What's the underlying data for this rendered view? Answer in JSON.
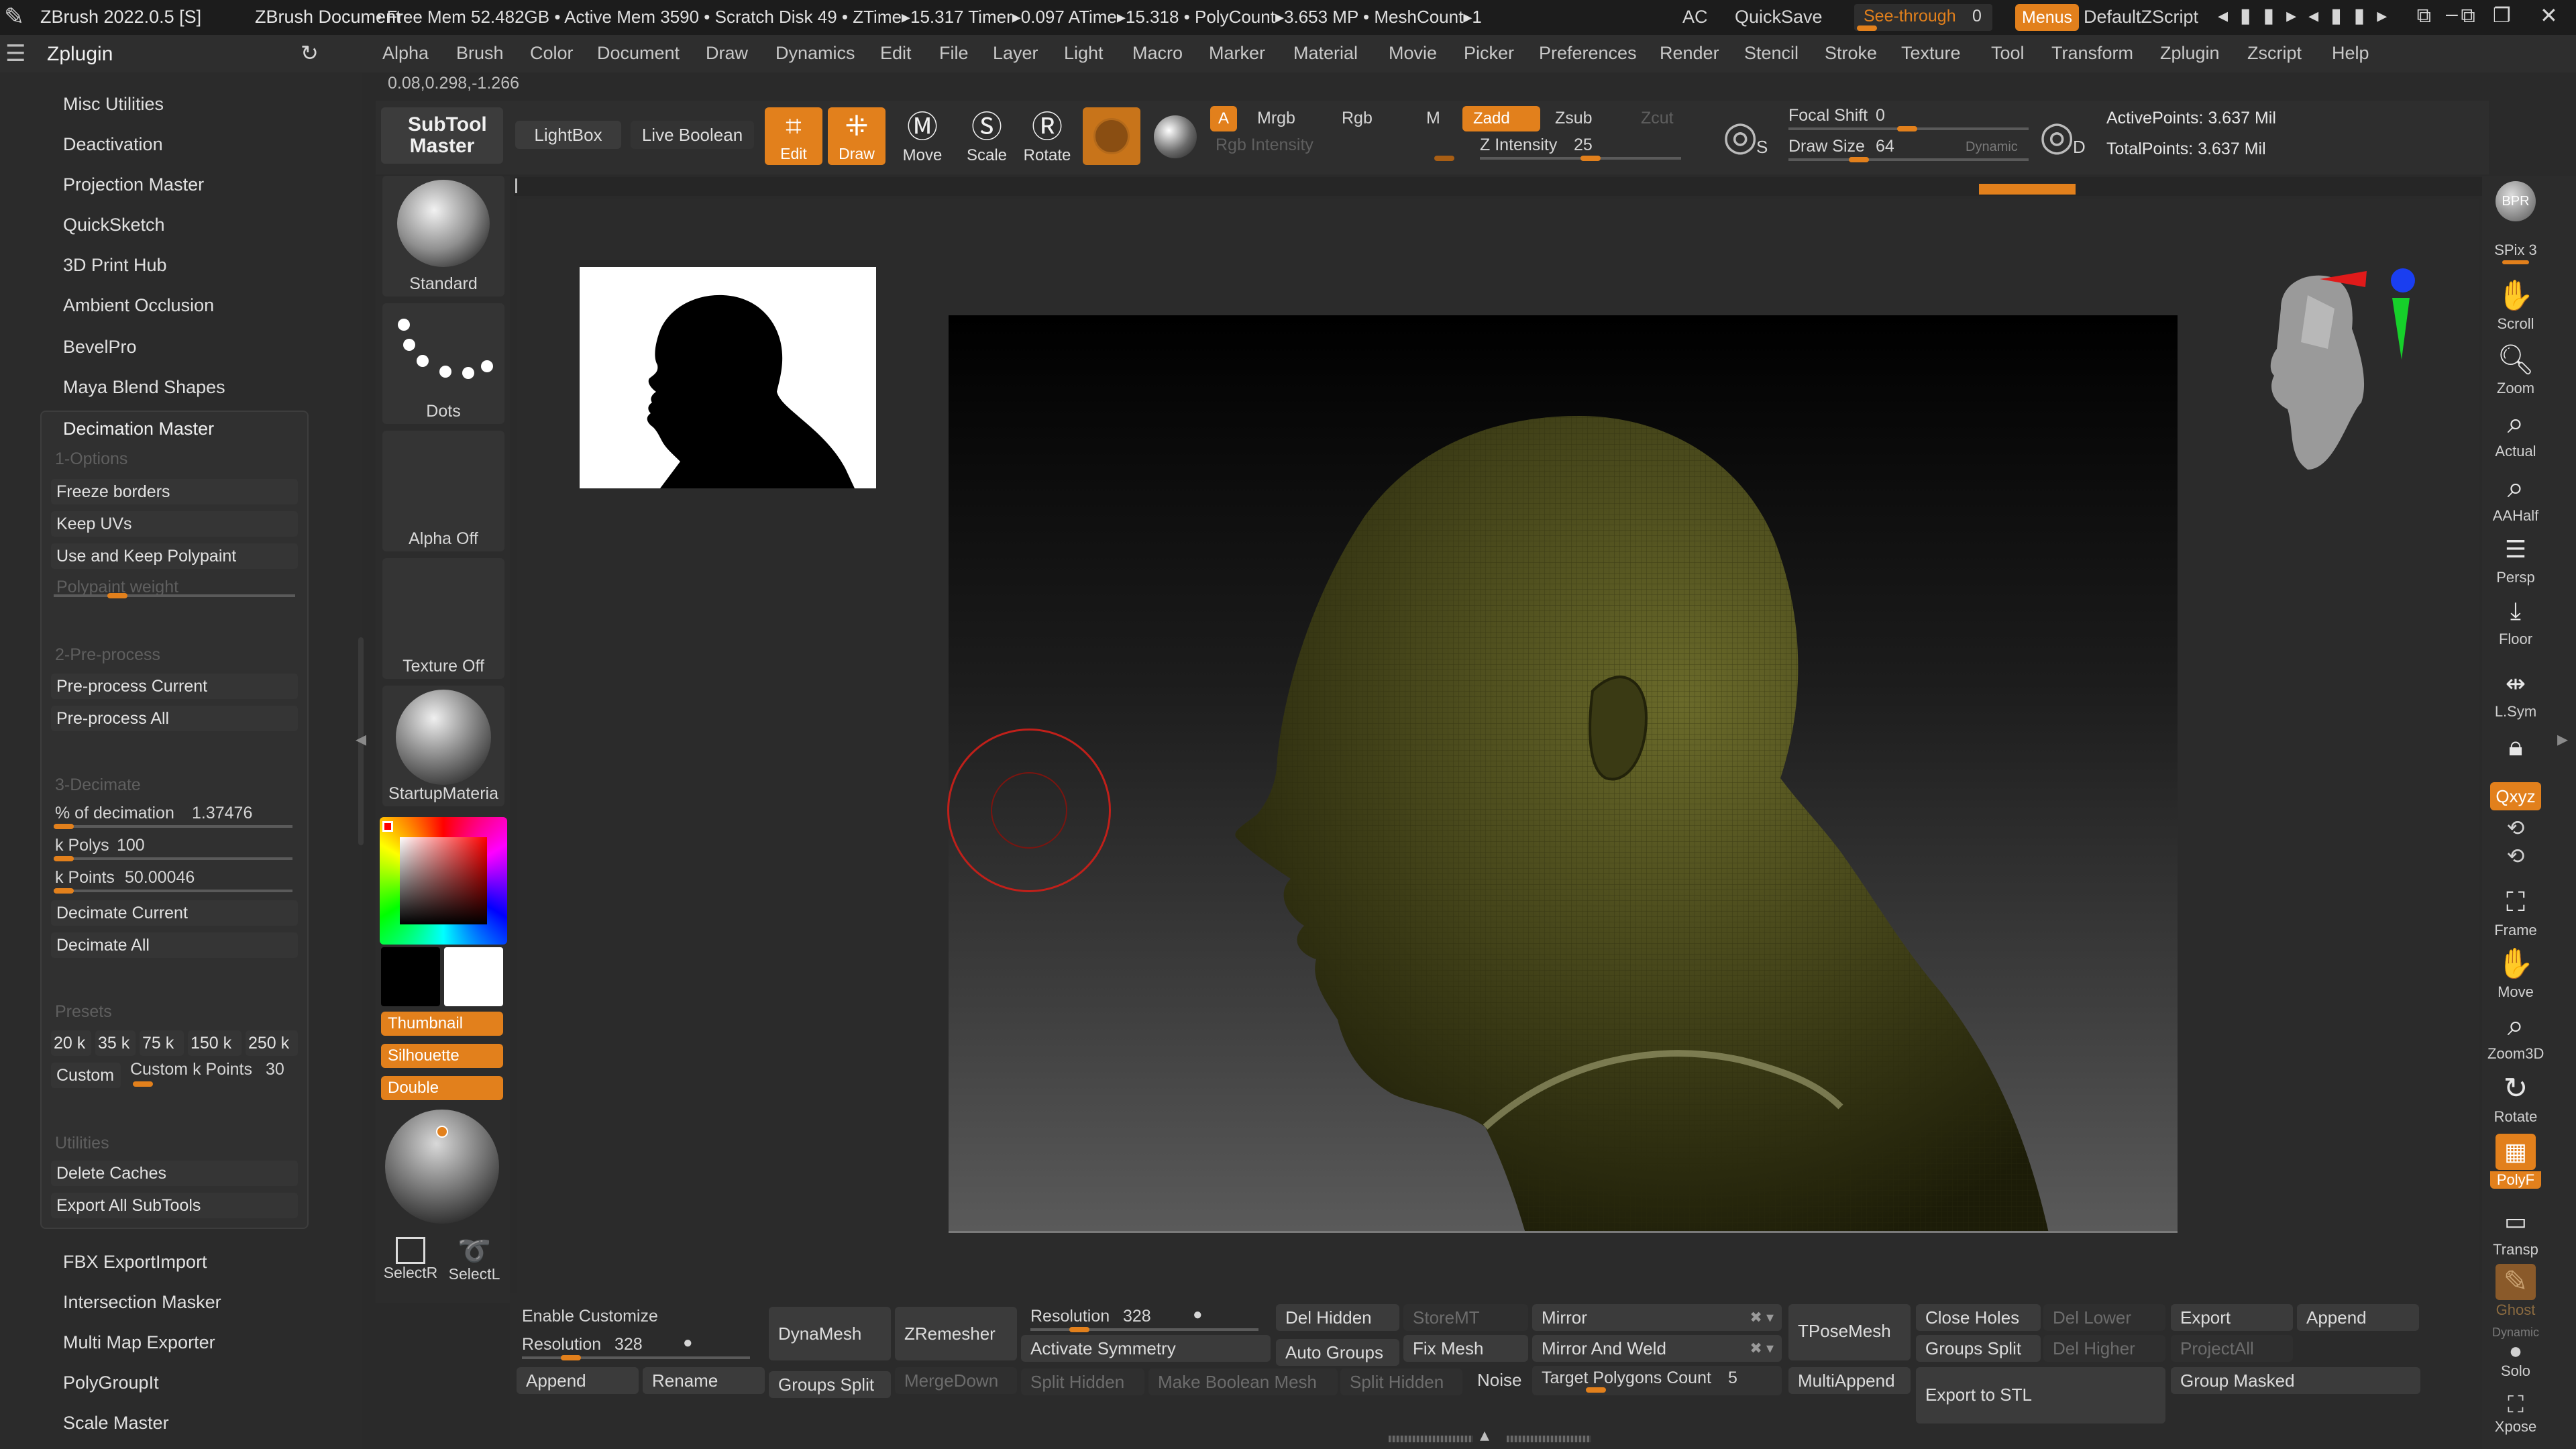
{
  "titlebar": {
    "app": "ZBrush 2022.0.5 [S]",
    "document": "ZBrush Document",
    "stats": "• Free Mem 52.482GB • Active Mem 3590 • Scratch Disk 49 • ZTime▸15.317 Timer▸0.097 ATime▸15.318 • PolyCount▸3.653 MP • MeshCount▸1",
    "ac": "AC",
    "quicksave": "QuickSave",
    "see_through_label": "See-through",
    "see_through_value": "0",
    "menus": "Menus",
    "default_zscript": "DefaultZScript"
  },
  "menubar": {
    "palette_title": "Zplugin",
    "items": [
      "Alpha",
      "Brush",
      "Color",
      "Document",
      "Draw",
      "Dynamics",
      "Edit",
      "File",
      "Layer",
      "Light",
      "Macro",
      "Marker",
      "Material",
      "Movie",
      "Picker",
      "Preferences",
      "Render",
      "Stencil",
      "Stroke",
      "Texture",
      "Tool",
      "Transform",
      "Zplugin",
      "Zscript",
      "Help"
    ]
  },
  "coords": "0.08,0.298,-1.266",
  "plugins_top": [
    "Misc Utilities",
    "Deactivation",
    "Projection Master",
    "QuickSketch",
    "3D Print Hub",
    "Ambient Occlusion",
    "BevelPro",
    "Maya Blend Shapes"
  ],
  "decimation": {
    "title": "Decimation Master",
    "options_head": "1-Options",
    "freeze": "Freeze borders",
    "keep_uvs": "Keep UVs",
    "keep_polypaint": "Use and Keep Polypaint",
    "polypaint_weight": "Polypaint weight",
    "preprocess_head": "2-Pre-process",
    "preprocess_current": "Pre-process Current",
    "preprocess_all": "Pre-process All",
    "decimate_head": "3-Decimate",
    "pct_label": "% of decimation",
    "pct_value": "1.37476",
    "kpolys_label": "k Polys",
    "kpolys_value": "100",
    "kpoints_label": "k Points",
    "kpoints_value": "50.00046",
    "decimate_current": "Decimate Current",
    "decimate_all": "Decimate All",
    "presets_head": "Presets",
    "presets": [
      "20 k",
      "35 k",
      "75 k",
      "150 k",
      "250 k"
    ],
    "custom": "Custom",
    "custom_points_label": "Custom k Points",
    "custom_points_value": "30",
    "utilities_head": "Utilities",
    "delete_caches": "Delete Caches",
    "export_all": "Export All SubTools"
  },
  "plugins_bottom": [
    "FBX ExportImport",
    "Intersection Masker",
    "Multi Map Exporter",
    "PolyGroupIt",
    "Scale Master"
  ],
  "toolbar": {
    "subtool_master": "SubTool Master",
    "lightbox": "LightBox",
    "live_boolean": "Live Boolean",
    "edit": "Edit",
    "draw": "Draw",
    "move": "Move",
    "scale": "Scale",
    "rotate": "Rotate",
    "a": "A",
    "mrgb": "Mrgb",
    "rgb": "Rgb",
    "m": "M",
    "rgb_intensity": "Rgb Intensity",
    "zadd": "Zadd",
    "zsub": "Zsub",
    "zcut": "Zcut",
    "z_intensity_label": "Z Intensity",
    "z_intensity_value": "25",
    "focal_shift_label": "Focal Shift",
    "focal_shift_value": "0",
    "draw_size_label": "Draw Size",
    "draw_size_value": "64",
    "dynamic": "Dynamic",
    "s": "S",
    "d": "D",
    "active_points": "ActivePoints: 3.637 Mil",
    "total_points": "TotalPoints: 3.637 Mil"
  },
  "left_shelf": {
    "standard": "Standard",
    "dots": "Dots",
    "alpha_off": "Alpha Off",
    "texture_off": "Texture Off",
    "material": "StartupMateria",
    "thumbnail": "Thumbnail",
    "silhouette": "Silhouette",
    "double": "Double",
    "select_r": "SelectR",
    "select_l": "SelectL"
  },
  "right_shelf": {
    "bpr": "BPR",
    "spix": "SPix 3",
    "scroll": "Scroll",
    "zoom": "Zoom",
    "actual": "Actual",
    "aahalf": "AAHalf",
    "persp": "Persp",
    "floor": "Floor",
    "lsym": "L.Sym",
    "xyz": "Qxyz",
    "frame": "Frame",
    "move": "Move",
    "zoom3d": "Zoom3D",
    "rotate": "Rotate",
    "polyf": "PolyF",
    "transp": "Transp",
    "ghost": "Ghost",
    "solo": "Solo",
    "xpose": "Xpose",
    "dynamic": "Dynamic"
  },
  "bottom": {
    "enable_customize": "Enable Customize",
    "resolution_label": "Resolution",
    "resolution_value": "328",
    "append": "Append",
    "rename": "Rename",
    "dynamesh": "DynaMesh",
    "groups_split": "Groups Split",
    "zremesher": "ZRemesher",
    "mergedown": "MergeDown",
    "resolution2_label": "Resolution",
    "resolution2_value": "328",
    "activate_symmetry": "Activate Symmetry",
    "split_hidden": "Split Hidden",
    "make_boolean": "Make Boolean Mesh",
    "split_hidden2": "Split Hidden",
    "del_hidden": "Del Hidden",
    "auto_groups": "Auto Groups",
    "storemt": "StoreMT",
    "fix_mesh": "Fix Mesh",
    "noise": "Noise",
    "mirror": "Mirror",
    "mirror_weld": "Mirror And Weld",
    "target_poly_label": "Target Polygons Count",
    "target_poly_value": "5",
    "tposemesh": "TPoseMesh",
    "multiappend": "MultiAppend",
    "close_holes": "Close Holes",
    "groups_split2": "Groups Split",
    "export_stl": "Export to STL",
    "del_lower": "Del Lower",
    "del_higher": "Del Higher",
    "export": "Export",
    "append2": "Append",
    "projectall": "ProjectAll",
    "group_masked": "Group Masked"
  },
  "colors": {
    "accent": "#e2801c",
    "bg": "#2a2a2a",
    "panel": "#333333",
    "button": "#3b3b3b"
  }
}
